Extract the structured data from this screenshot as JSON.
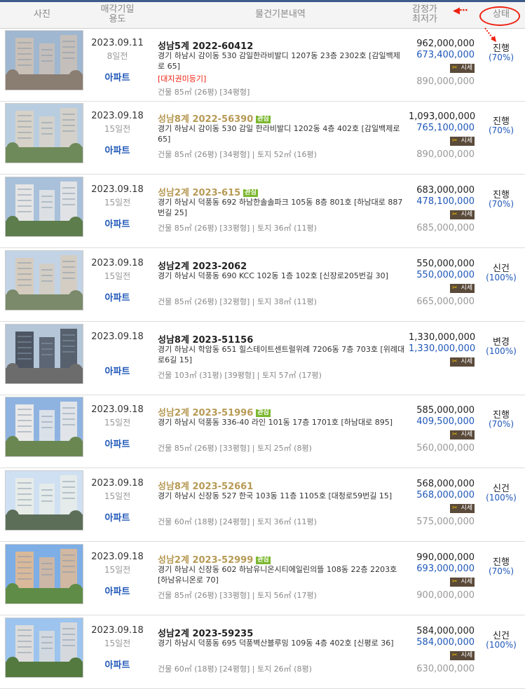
{
  "header": {
    "photo": "사진",
    "date_line1": "매각기일",
    "date_line2": "용도",
    "info": "물건기본내역",
    "price_line1": "감정가",
    "price_line2": "최저가",
    "status": "상태"
  },
  "sise_label": "시세",
  "rows": [
    {
      "date": "2023.09.11",
      "ago": "8일전",
      "use": "아파트",
      "case": "성남5계 2022-60412",
      "gold": false,
      "badge": "",
      "addr": "경기 하남시 감이동 530 감일한라비발디 1207동 23층 2302호 [감일백제로 65]",
      "note": "[대지권미등기]",
      "area": "건물 85㎡ (26평) [34평형]",
      "appraisal": "962,000,000",
      "minimum": "673,400,000",
      "market": "890,000,000",
      "status": "진행",
      "pct": "(70%)"
    },
    {
      "date": "2023.09.18",
      "ago": "15일전",
      "use": "아파트",
      "case": "성남8계 2022-56390",
      "gold": true,
      "badge": "관심",
      "addr": "경기 하남시 감이동 530 감일 한라비발디 1202동 4층 402호 [감일백제로 65]",
      "note": "",
      "area": "건물 85㎡ (26평) [34평형]  |  토지 52㎡ (16평)",
      "appraisal": "1,093,000,000",
      "minimum": "765,100,000",
      "market": "890,000,000",
      "status": "진행",
      "pct": "(70%)"
    },
    {
      "date": "2023.09.18",
      "ago": "15일전",
      "use": "아파트",
      "case": "성남2계 2023-615",
      "gold": true,
      "badge": "관심",
      "addr": "경기 하남시 덕풍동 692 하남한솔솔파크 105동 8층 801호 [하남대로 887번길 25]",
      "note": "",
      "area": "건물 85㎡ (26평) [33평형]  |  토지 36㎡ (11평)",
      "appraisal": "683,000,000",
      "minimum": "478,100,000",
      "market": "685,000,000",
      "status": "진행",
      "pct": "(70%)"
    },
    {
      "date": "2023.09.18",
      "ago": "15일전",
      "use": "아파트",
      "case": "성남2계 2023-2062",
      "gold": false,
      "badge": "",
      "addr": "경기 하남시 덕풍동 690 KCC 102동 1층 102호 [신장로205번길 30]",
      "note": "",
      "area": "건물 85㎡ (26평) [32평형]  |  토지 38㎡ (11평)",
      "appraisal": "550,000,000",
      "minimum": "550,000,000",
      "market": "665,000,000",
      "status": "신건",
      "pct": "(100%)"
    },
    {
      "date": "2023.09.18",
      "ago": "",
      "use": "아파트",
      "case": "성남8계 2023-51156",
      "gold": false,
      "badge": "",
      "addr": "경기 하남시 학암동 651 힐스테이트센트럴위례 7206동 7층 703호 [위례대로6길 15]",
      "note": "",
      "area": "건물 103㎡ (31평) [39평형]  |  토지 57㎡ (17평)",
      "appraisal": "1,330,000,000",
      "minimum": "1,330,000,000",
      "market": "",
      "status": "변경",
      "pct": "(100%)"
    },
    {
      "date": "2023.09.18",
      "ago": "15일전",
      "use": "아파트",
      "case": "성남2계 2023-51996",
      "gold": true,
      "badge": "관심",
      "addr": "경기 하남시 덕풍동 336-40 라인 101동 17층 1701호 [하남대로 895]",
      "note": "",
      "area": "건물 85㎡ (26평) [33평형]  |  토지 25㎡ (8평)",
      "appraisal": "585,000,000",
      "minimum": "409,500,000",
      "market": "560,000,000",
      "status": "진행",
      "pct": "(70%)"
    },
    {
      "date": "2023.09.18",
      "ago": "15일전",
      "use": "아파트",
      "case": "성남8계 2023-52661",
      "gold": true,
      "badge": "",
      "addr": "경기 하남시 신장동 527 한국 103동 11층 1105호 [대청로59번길 15]",
      "note": "",
      "area": "건물 60㎡ (18평) [24평형]  |  토지 36㎡ (11평)",
      "appraisal": "568,000,000",
      "minimum": "568,000,000",
      "market": "575,000,000",
      "status": "신건",
      "pct": "(100%)"
    },
    {
      "date": "2023.09.18",
      "ago": "15일전",
      "use": "아파트",
      "case": "성남2계 2023-52999",
      "gold": true,
      "badge": "관심",
      "addr": "경기 하남시 신장동 602 하남유니온시티에일린의뜰 108동 22층 2203호 [하남유니온로 70]",
      "note": "",
      "area": "건물 85㎡ (26평) [33평형]  |  토지 56㎡ (17평)",
      "appraisal": "990,000,000",
      "minimum": "693,000,000",
      "market": "900,000,000",
      "status": "진행",
      "pct": "(70%)"
    },
    {
      "date": "2023.09.18",
      "ago": "15일전",
      "use": "아파트",
      "case": "성남2계 2023-59235",
      "gold": false,
      "badge": "",
      "addr": "경기 하남시 덕풍동 695 덕풍벽산블루밍 109동 4층 402호 [신평로 36]",
      "note": "",
      "area": "건물 60㎡ (18평) [24평형]  |  토지 26㎡ (8평)",
      "appraisal": "584,000,000",
      "minimum": "584,000,000",
      "market": "630,000,000",
      "status": "신건",
      "pct": "(100%)"
    }
  ]
}
